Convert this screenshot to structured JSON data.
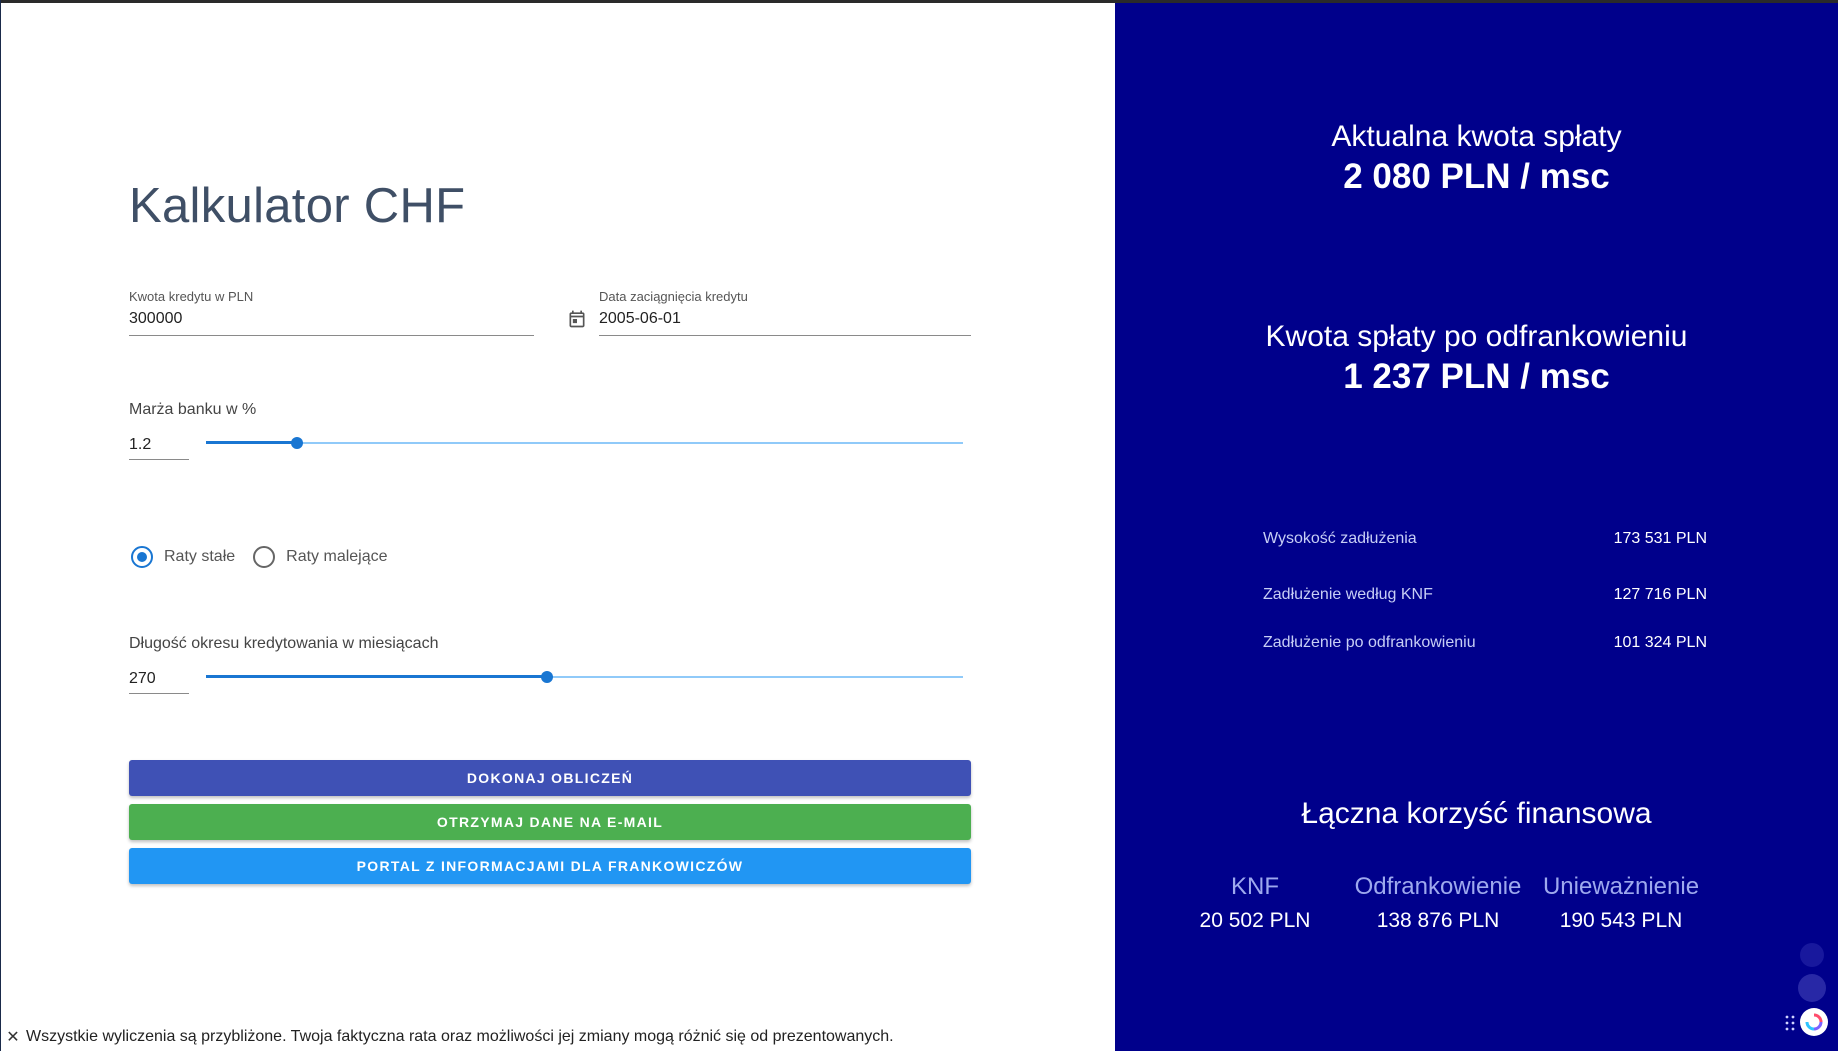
{
  "calculator": {
    "title": "Kalkulator CHF",
    "amount": {
      "label": "Kwota kredytu w PLN",
      "value": "300000"
    },
    "date": {
      "label": "Data zaciągnięcia kredytu",
      "value": "2005-06-01",
      "icon": "calendar-icon"
    },
    "margin": {
      "label": "Marża banku w %",
      "value": "1.2",
      "slider_fraction": 0.12
    },
    "installments": {
      "options": [
        {
          "label": "Raty stałe",
          "checked": true
        },
        {
          "label": "Raty malejące",
          "checked": false
        }
      ]
    },
    "period": {
      "label": "Długość okresu kredytowania w miesiącach",
      "value": "270",
      "slider_fraction": 0.45
    },
    "buttons": {
      "calculate": "DOKONAJ OBLICZEŃ",
      "email": "OTRZYMAJ DANE NA E-MAIL",
      "portal": "PORTAL Z INFORMACJAMI DLA FRANKOWICZÓW"
    },
    "footer": {
      "close_icon": "close-icon",
      "disclaimer": "Wszystkie wyliczenia są przybliżone. Twoja faktyczna rata oraz możliwości jej zmiany mogą różnić się od prezentowanych."
    }
  },
  "results": {
    "current": {
      "heading": "Aktualna kwota spłaty",
      "value": "2 080 PLN / msc"
    },
    "after": {
      "heading": "Kwota spłaty po odfrankowieniu",
      "value": "1 237 PLN / msc"
    },
    "stats": [
      {
        "label": "Wysokość zadłużenia",
        "value": "173 531 PLN"
      },
      {
        "label": "Zadłużenie według KNF",
        "value": "127 716 PLN"
      },
      {
        "label": "Zadłużenie po odfrankowieniu",
        "value": "101 324 PLN"
      }
    ],
    "benefit": {
      "title": "Łączna korzyść finansowa",
      "items": [
        {
          "label": "KNF",
          "value": "20 502 PLN"
        },
        {
          "label": "Odfrankowienie",
          "value": "138 876 PLN"
        },
        {
          "label": "Unieważnienie",
          "value": "190 543 PLN"
        }
      ]
    }
  },
  "colors": {
    "panel_blue": "#00008b",
    "btn_calculate": "#3f51b5",
    "btn_email": "#4caf50",
    "btn_portal": "#2196f3",
    "accent": "#1976d2"
  }
}
